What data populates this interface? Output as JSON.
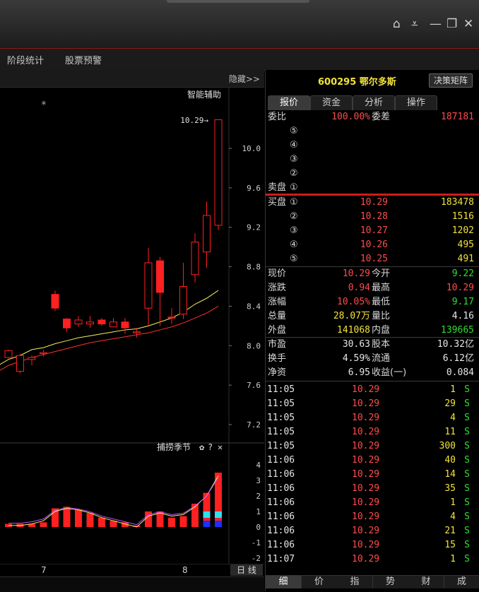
{
  "menu": {
    "items": [
      "阶段统计",
      "股票预警"
    ]
  },
  "chart": {
    "hide_label": "隐藏>>",
    "assist_label": "智能辅助",
    "marker": "*",
    "max_label": "10.29→",
    "price_ticks": [
      "10.0",
      "9.6",
      "9.2",
      "8.8",
      "8.4",
      "8.0",
      "7.6",
      "7.2"
    ],
    "indicator_title": "捕捞季节",
    "indicator_ticks": [
      "4",
      "3",
      "2",
      "1",
      "0",
      "-1",
      "-2"
    ],
    "x_ticks": [
      "7",
      "8"
    ],
    "period_label": "日 线",
    "colors": {
      "up": "#ff2020",
      "ma1": "#f0f060",
      "ma2": "#ff3030",
      "down": "#20c0ff"
    }
  },
  "chart_data": {
    "type": "candlestick",
    "candles": [
      {
        "o": 7.88,
        "c": 7.95,
        "h": 7.96,
        "l": 7.87
      },
      {
        "o": 7.74,
        "c": 7.9,
        "h": 7.92,
        "l": 7.72
      },
      {
        "o": 7.86,
        "c": 7.88,
        "h": 7.9,
        "l": 7.8
      },
      {
        "o": 7.93,
        "c": 7.93,
        "h": 7.96,
        "l": 7.89
      },
      {
        "o": 8.52,
        "c": 8.38,
        "h": 8.56,
        "l": 8.35
      },
      {
        "o": 8.27,
        "c": 8.18,
        "h": 8.28,
        "l": 8.14
      },
      {
        "o": 8.22,
        "c": 8.26,
        "h": 8.3,
        "l": 8.19
      },
      {
        "o": 8.22,
        "c": 8.24,
        "h": 8.3,
        "l": 8.18
      },
      {
        "o": 8.26,
        "c": 8.22,
        "h": 8.28,
        "l": 8.2
      },
      {
        "o": 8.19,
        "c": 8.24,
        "h": 8.28,
        "l": 8.19
      },
      {
        "o": 8.24,
        "c": 8.18,
        "h": 8.28,
        "l": 8.12
      },
      {
        "o": 8.14,
        "c": 8.14,
        "h": 8.18,
        "l": 8.08
      },
      {
        "o": 8.38,
        "c": 8.84,
        "h": 8.99,
        "l": 8.2
      },
      {
        "o": 8.86,
        "c": 8.54,
        "h": 8.9,
        "l": 8.2
      },
      {
        "o": 8.29,
        "c": 8.28,
        "h": 8.38,
        "l": 8.22
      },
      {
        "o": 8.32,
        "c": 8.6,
        "h": 8.84,
        "l": 8.27
      },
      {
        "o": 8.72,
        "c": 9.05,
        "h": 9.14,
        "l": 8.64
      },
      {
        "o": 8.95,
        "c": 9.32,
        "h": 9.46,
        "l": 8.79
      },
      {
        "o": 9.22,
        "c": 10.29,
        "h": 10.29,
        "l": 9.17
      }
    ],
    "ma1": [
      7.86,
      7.9,
      7.96,
      7.98,
      8.02,
      8.05,
      8.08,
      8.1,
      8.12,
      8.14,
      8.16,
      8.17,
      8.2,
      8.24,
      8.28,
      8.34,
      8.42,
      8.48,
      8.56
    ],
    "ma2": [
      7.8,
      7.84,
      7.88,
      7.91,
      7.94,
      7.97,
      8.0,
      8.03,
      8.05,
      8.07,
      8.09,
      8.11,
      8.13,
      8.16,
      8.19,
      8.23,
      8.28,
      8.33,
      8.4
    ],
    "indicator_bars": [
      0.2,
      0.2,
      0.2,
      0.3,
      1.2,
      1.3,
      1.1,
      0.9,
      0.6,
      0.4,
      0.3,
      0.1,
      1.0,
      1.0,
      0.6,
      0.7,
      1.5,
      2.2,
      3.5
    ],
    "indicator_line": [
      0.1,
      0.1,
      0.2,
      0.4,
      1.0,
      1.2,
      1.1,
      0.9,
      0.6,
      0.4,
      0.2,
      0.0,
      0.7,
      0.9,
      0.7,
      0.8,
      1.3,
      2.0,
      3.3
    ]
  },
  "quote": {
    "code_name": "600295 鄂尔多斯",
    "matrix_btn": "决策矩阵",
    "tabs": [
      "报价",
      "资金",
      "分析",
      "操作"
    ],
    "weibi_label": "委比",
    "weibi": "100.00%",
    "weicha_label": "委差",
    "weicha": "187181",
    "sell_label": "卖盘",
    "sell_levels": [
      "⑤",
      "④",
      "③",
      "②",
      "①"
    ],
    "buy_label": "买盘",
    "buy": [
      {
        "lv": "①",
        "price": "10.29",
        "vol": "183478"
      },
      {
        "lv": "②",
        "price": "10.28",
        "vol": "1516"
      },
      {
        "lv": "③",
        "price": "10.27",
        "vol": "1202"
      },
      {
        "lv": "④",
        "price": "10.26",
        "vol": "495"
      },
      {
        "lv": "⑤",
        "price": "10.25",
        "vol": "491"
      }
    ],
    "stats": [
      {
        "l1": "现价",
        "v1": "10.29",
        "l2": "今开",
        "v2": "9.22"
      },
      {
        "l1": "涨跌",
        "v1": "0.94",
        "l2": "最高",
        "v2": "10.29"
      },
      {
        "l1": "涨幅",
        "v1": "10.05%",
        "l2": "最低",
        "v2": "9.17"
      },
      {
        "l1": "总量",
        "v1": "28.07万",
        "l2": "量比",
        "v2": "4.16"
      },
      {
        "l1": "外盘",
        "v1": "141068",
        "l2": "内盘",
        "v2": "139665"
      }
    ],
    "fund": [
      {
        "l1": "市盈",
        "v1": "30.63",
        "l2": "股本",
        "v2": "10.32亿"
      },
      {
        "l1": "换手",
        "v1": "4.59%",
        "l2": "流通",
        "v2": "6.12亿"
      },
      {
        "l1": "净资",
        "v1": "6.95",
        "l2": "收益(一)",
        "v2": "0.084"
      }
    ],
    "ticks": [
      {
        "t": "11:05",
        "p": "10.29",
        "v": "1",
        "s": "S"
      },
      {
        "t": "11:05",
        "p": "10.29",
        "v": "29",
        "s": "S"
      },
      {
        "t": "11:05",
        "p": "10.29",
        "v": "4",
        "s": "S"
      },
      {
        "t": "11:05",
        "p": "10.29",
        "v": "11",
        "s": "S"
      },
      {
        "t": "11:05",
        "p": "10.29",
        "v": "300",
        "s": "S"
      },
      {
        "t": "11:06",
        "p": "10.29",
        "v": "40",
        "s": "S"
      },
      {
        "t": "11:06",
        "p": "10.29",
        "v": "14",
        "s": "S"
      },
      {
        "t": "11:06",
        "p": "10.29",
        "v": "35",
        "s": "S"
      },
      {
        "t": "11:06",
        "p": "10.29",
        "v": "1",
        "s": "S"
      },
      {
        "t": "11:06",
        "p": "10.29",
        "v": "4",
        "s": "S"
      },
      {
        "t": "11:06",
        "p": "10.29",
        "v": "21",
        "s": "S"
      },
      {
        "t": "11:06",
        "p": "10.29",
        "v": "15",
        "s": "S"
      },
      {
        "t": "11:07",
        "p": "10.29",
        "v": "1",
        "s": "S"
      }
    ],
    "bottom_tabs": [
      "细",
      "价",
      "指",
      "势",
      "财",
      "成"
    ]
  }
}
